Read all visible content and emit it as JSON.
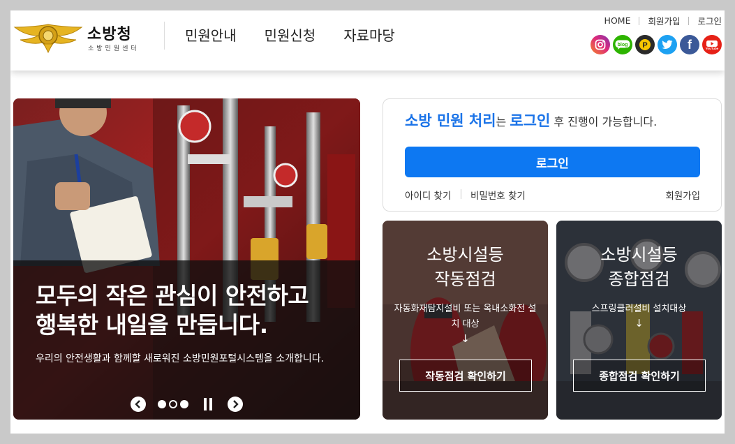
{
  "brand": {
    "title": "소방청",
    "subtitle": "소방민원센터"
  },
  "gnb": [
    "민원안내",
    "민원신청",
    "자료마당"
  ],
  "util": {
    "home": "HOME",
    "join": "회원가입",
    "login": "로그인"
  },
  "sns": [
    {
      "name": "instagram-icon",
      "glyph": "◎",
      "color": "#d62976"
    },
    {
      "name": "blog-icon",
      "glyph": "blog",
      "color": "#2db400"
    },
    {
      "name": "post-icon",
      "glyph": "P",
      "color": "#2a2a2a"
    },
    {
      "name": "twitter-icon",
      "glyph": "🐦",
      "color": "#1da1f2"
    },
    {
      "name": "facebook-icon",
      "glyph": "f",
      "color": "#3b5998"
    },
    {
      "name": "youtube-icon",
      "glyph": "▶",
      "color": "#e62117"
    }
  ],
  "hero": {
    "title": "모두의 작은 관심이 안전하고\n행복한 내일을 만듭니다.",
    "desc": "우리의 안전생활과 함께할 새로워진 소방민원포털시스템을 소개합니다.",
    "slides": 3,
    "active_slide": 2
  },
  "login": {
    "hl1": "소방 민원 처리",
    "t1": "는 ",
    "hl2": "로그인",
    "t2": " 후 진행이 가능합니다.",
    "button": "로그인",
    "find_id": "아이디 찾기",
    "find_pw": "비밀번호 찾기",
    "join": "회원가입"
  },
  "cards": [
    {
      "title": "소방시설등\n작동점검",
      "desc": "자동화재탐지설비 또는 옥내소화전 설치 대상",
      "arrow": "↓",
      "button": "작동점검 확인하기"
    },
    {
      "title": "소방시설등\n종합점검",
      "desc": "스프링클러설비 설치대상",
      "arrow": "↓",
      "button": "종합점검 확인하기"
    }
  ],
  "colors": {
    "accent": "#0d78f2",
    "highlight": "#1a73e8"
  }
}
